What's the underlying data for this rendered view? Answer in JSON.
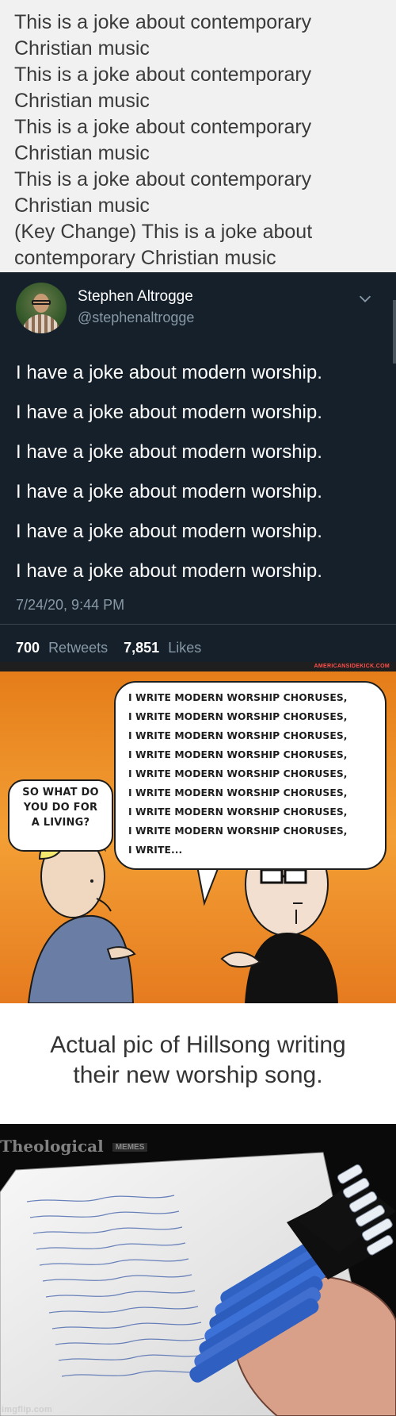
{
  "panel1": {
    "lines": [
      "This is a joke about contemporary",
      "Christian music",
      "This is a joke about contemporary",
      "Christian music",
      "This is a joke about contemporary",
      "Christian music",
      "This is a joke about contemporary",
      "Christian music",
      "(Key Change) This is a joke about",
      "contemporary Christian music"
    ]
  },
  "tweet": {
    "name": "Stephen Altrogge",
    "handle": "@stephenaltrogge",
    "lines": [
      "I have a joke about modern worship.",
      "I have a joke about modern worship.",
      "I have a joke about modern worship.",
      "I have a joke about modern worship.",
      "I have a joke about modern worship.",
      "I have a joke about modern worship."
    ],
    "timestamp": "7/24/20, 9:44 PM",
    "retweets_count": "700",
    "retweets_label": "Retweets",
    "likes_count": "7,851",
    "likes_label": "Likes"
  },
  "comic": {
    "brand": "AMERICANSIDEKICK.COM",
    "left_bubble": [
      "SO WHAT DO",
      "YOU DO FOR",
      "A LIVING?"
    ],
    "right_bubble": [
      "I WRITE MODERN WORSHIP CHORUSES,",
      "I WRITE MODERN WORSHIP CHORUSES,",
      "I WRITE MODERN WORSHIP CHORUSES,",
      "I WRITE MODERN WORSHIP CHORUSES,",
      "I WRITE MODERN WORSHIP CHORUSES,",
      "I WRITE MODERN WORSHIP CHORUSES,",
      "I WRITE MODERN WORSHIP CHORUSES,",
      "I WRITE MODERN WORSHIP CHORUSES,",
      "I WRITE..."
    ]
  },
  "meme": {
    "caption_line1": "Actual pic of Hillsong writing",
    "caption_line2": "their new worship song.",
    "watermark": "Theological",
    "watermark_sub": "MEMES",
    "imgflip": "imgflip.com"
  },
  "icons": {
    "tweet_menu": "chevron-down-icon",
    "avatar": "avatar-photo"
  },
  "colors": {
    "tweet_background": "#15202b",
    "tweet_secondary": "#8899a6",
    "comic_orange": "#f09a2e",
    "text_panel_background": "#f1f1f1"
  }
}
